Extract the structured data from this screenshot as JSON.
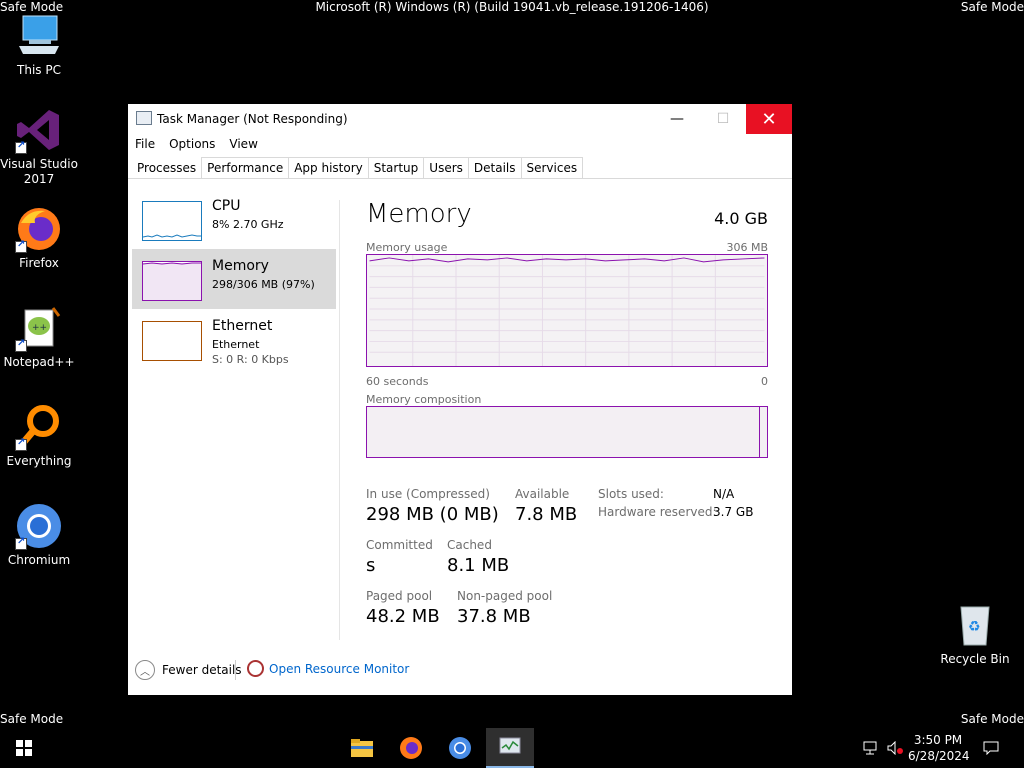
{
  "desktop": {
    "safe_mode_label": "Safe Mode",
    "build_string": "Microsoft (R) Windows (R) (Build 19041.vb_release.191206-1406)",
    "icons": [
      {
        "label": "This PC"
      },
      {
        "label": "Visual Studio 2017"
      },
      {
        "label": "Firefox"
      },
      {
        "label": "Notepad++"
      },
      {
        "label": "Everything"
      },
      {
        "label": "Chromium"
      },
      {
        "label": "Recycle Bin"
      }
    ]
  },
  "window": {
    "title": "Task Manager (Not Responding)",
    "controls": {
      "minimize": "—",
      "maximize": "☐",
      "close": "✕"
    },
    "menu": [
      "File",
      "Options",
      "View"
    ],
    "tabs": [
      "Processes",
      "Performance",
      "App history",
      "Startup",
      "Users",
      "Details",
      "Services"
    ],
    "active_tab": "Processes",
    "sidebar": [
      {
        "name": "CPU",
        "sub1": "8%  2.70 GHz",
        "sub2": "",
        "color": "#1a7bbd"
      },
      {
        "name": "Memory",
        "sub1": "298/306 MB (97%)",
        "sub2": "",
        "color": "#8b12ae",
        "selected": true
      },
      {
        "name": "Ethernet",
        "sub1": "Ethernet",
        "sub2": "S: 0  R: 0 Kbps",
        "color": "#a74f01"
      }
    ],
    "main": {
      "title": "Memory",
      "total": "4.0 GB",
      "usage_label": "Memory usage",
      "usage_max": "306 MB",
      "time_left": "60 seconds",
      "time_right": "0",
      "composition_label": "Memory composition",
      "stats": {
        "in_use_label": "In use (Compressed)",
        "in_use_value": "298 MB (0 MB)",
        "available_label": "Available",
        "available_value": "7.8 MB",
        "slots_label": "Slots used:",
        "slots_value": "N/A",
        "hw_reserved_label": "Hardware reserved:",
        "hw_reserved_value": "3.7 GB",
        "committed_label": "Committed",
        "committed_value": "s",
        "cached_label": "Cached",
        "cached_value": "8.1 MB",
        "paged_label": "Paged pool",
        "paged_value": "48.2 MB",
        "nonpaged_label": "Non-paged pool",
        "nonpaged_value": "37.8 MB"
      }
    },
    "footer": {
      "fewer_details": "Fewer details",
      "open_resource_monitor": "Open Resource Monitor"
    },
    "accent_color": "#8b12ae"
  },
  "taskbar": {
    "apps": [
      "file-explorer",
      "firefox",
      "chromium",
      "task-manager"
    ],
    "clock_time": "3:50 PM",
    "clock_date": "6/28/2024"
  }
}
